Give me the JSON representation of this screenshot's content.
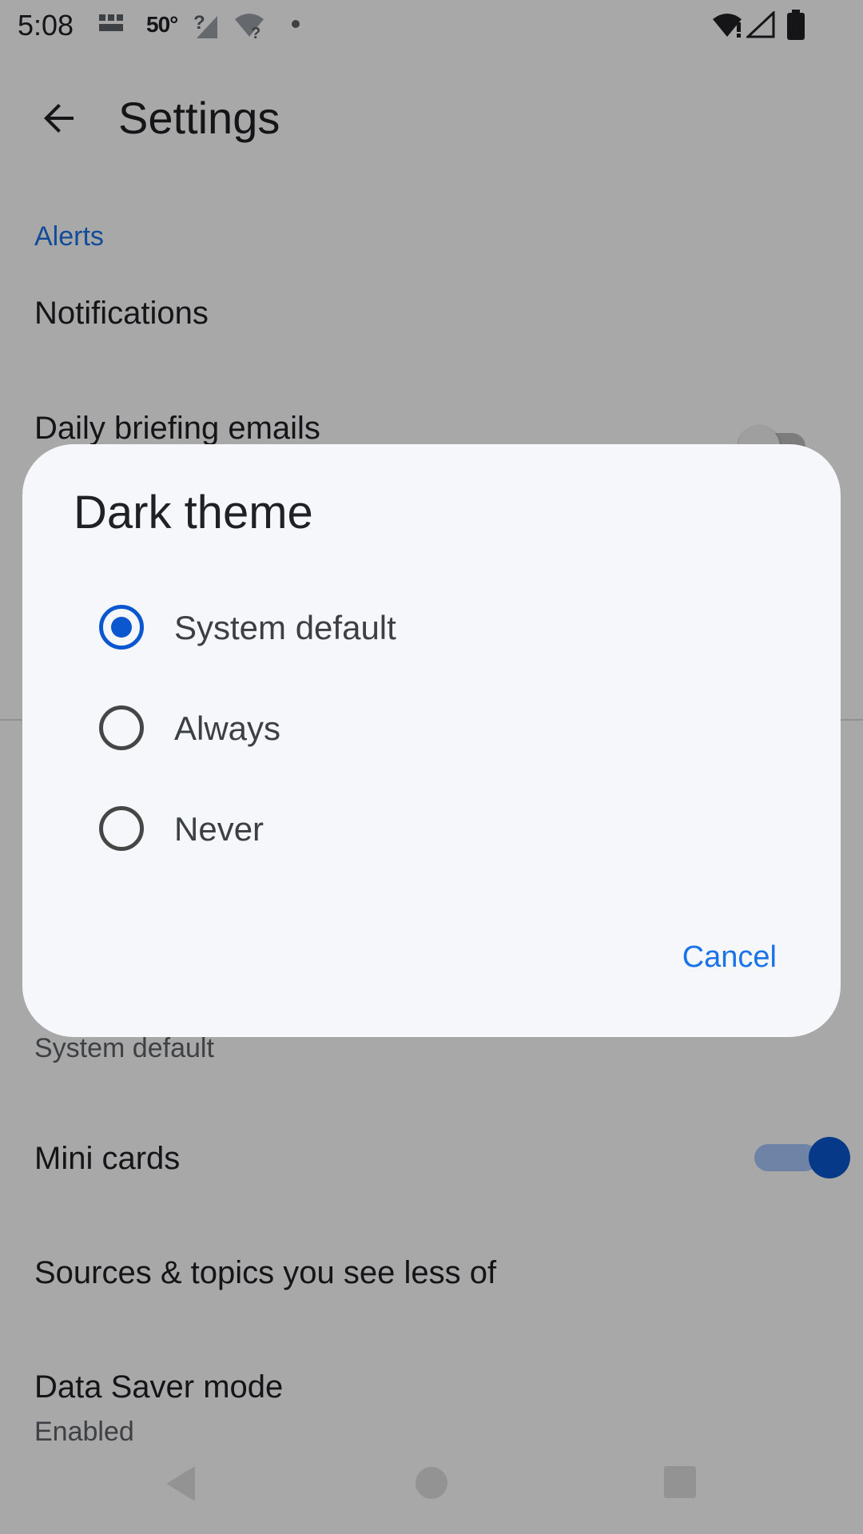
{
  "status_bar": {
    "time": "5:08",
    "temperature": "50°",
    "icons": [
      "bbc-news-icon",
      "no-signal-icon",
      "wifi-unknown-icon",
      "dot-icon",
      "wifi-icon",
      "cell-signal-icon",
      "battery-icon"
    ]
  },
  "app_bar": {
    "back_icon": "arrow-back-icon",
    "title": "Settings"
  },
  "settings": {
    "alerts_header": "Alerts",
    "notifications": "Notifications",
    "daily_briefing": "Daily briefing emails",
    "dark_theme_sub": "System default",
    "mini_cards": "Mini cards",
    "mini_cards_enabled": true,
    "sources_topics": "Sources & topics you see less of",
    "data_saver": "Data Saver mode",
    "data_saver_sub": "Enabled"
  },
  "dialog": {
    "title": "Dark theme",
    "options": [
      {
        "label": "System default",
        "selected": true
      },
      {
        "label": "Always",
        "selected": false
      },
      {
        "label": "Never",
        "selected": false
      }
    ],
    "cancel": "Cancel"
  },
  "colors": {
    "accent": "#1a73e8",
    "radio_selected": "#0b57d0",
    "dialog_bg": "#f6f7fb"
  },
  "nav_bar": {
    "icons": [
      "nav-back-icon",
      "nav-home-icon",
      "nav-recents-icon"
    ]
  }
}
